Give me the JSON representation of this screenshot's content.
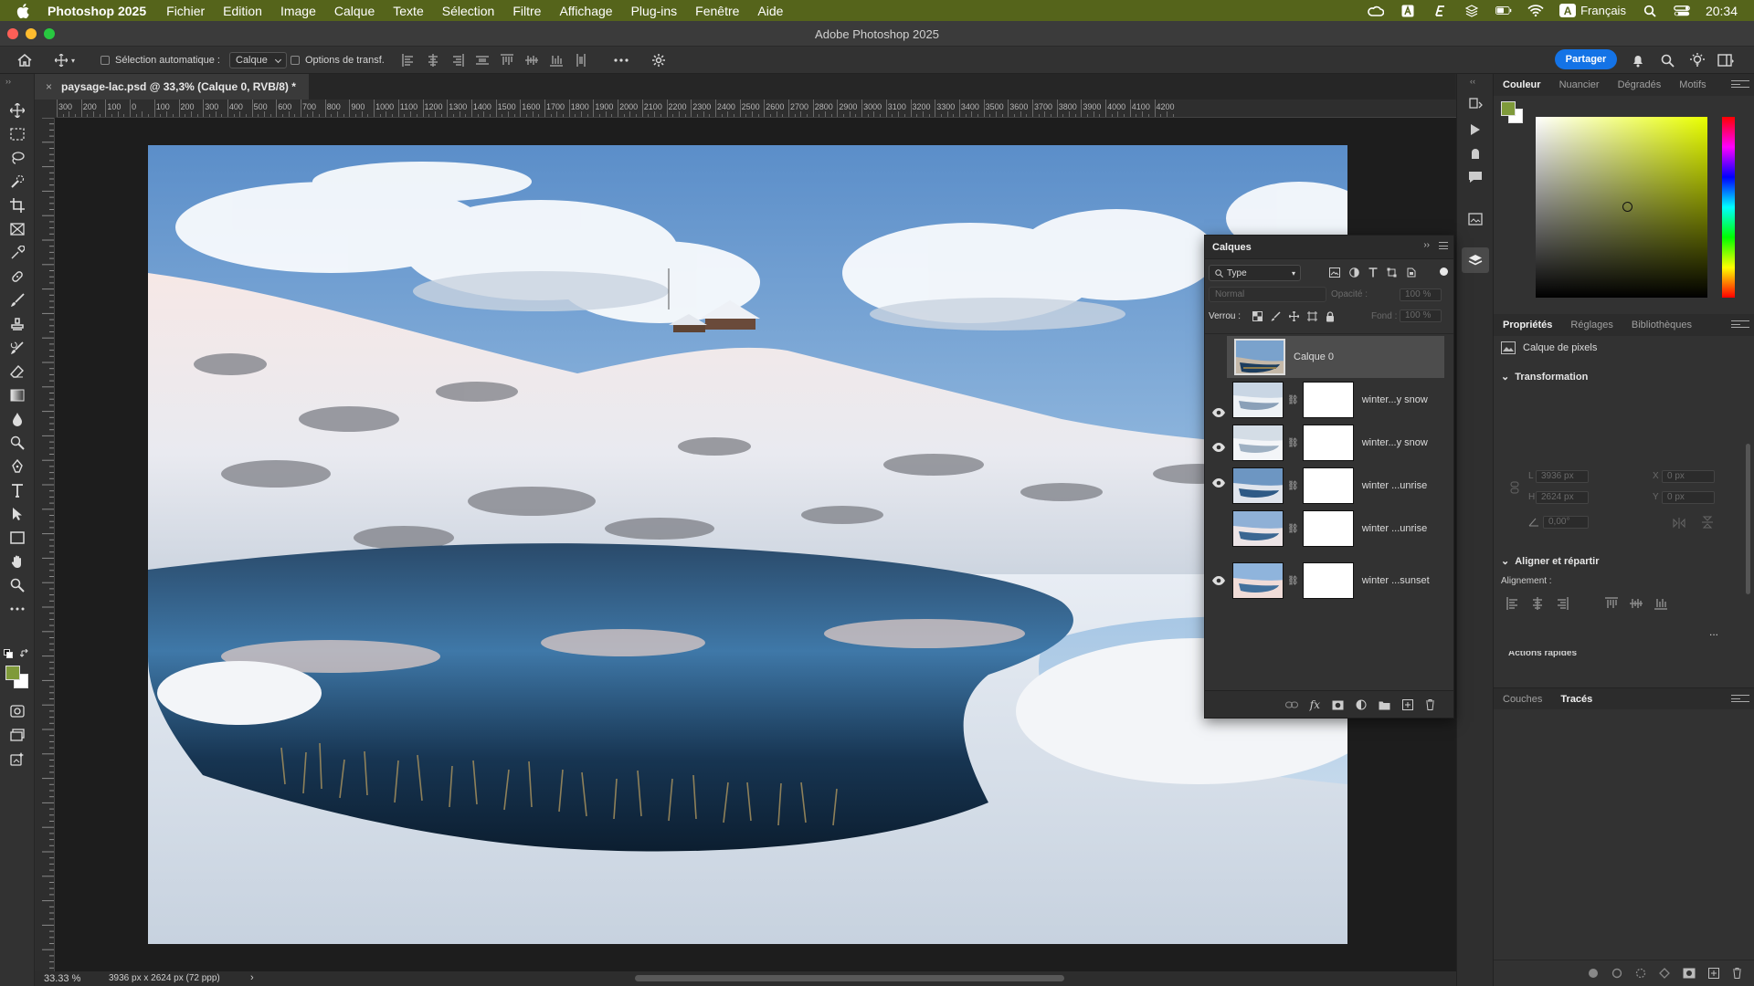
{
  "system": {
    "app_name": "Photoshop 2025",
    "menus": [
      "Fichier",
      "Edition",
      "Image",
      "Calque",
      "Texte",
      "Sélection",
      "Filtre",
      "Affichage",
      "Plug-ins",
      "Fenêtre",
      "Aide"
    ],
    "input_source": "Français",
    "input_badge": "A",
    "clock": "20:34"
  },
  "window": {
    "title": "Adobe Photoshop 2025"
  },
  "options_bar": {
    "auto_select_label": "Sélection automatique :",
    "auto_select_value": "Calque",
    "transform_label": "Options de transf.",
    "share_label": "Partager"
  },
  "document": {
    "tab_title": "paysage-lac.psd @ 33,3% (Calque 0, RVB/8) *",
    "ruler_ticks": [
      "300",
      "200",
      "100",
      "0",
      "100",
      "200",
      "300",
      "400",
      "500",
      "600",
      "700",
      "800",
      "900",
      "1000",
      "1100",
      "1200",
      "1300",
      "1400",
      "1500",
      "1600",
      "1700",
      "1800",
      "1900",
      "2000",
      "2100",
      "2200",
      "2300",
      "2400",
      "2500",
      "2600",
      "2700",
      "2800",
      "2900",
      "3000",
      "3100",
      "3200",
      "3300",
      "3400",
      "3500",
      "3600",
      "3700",
      "3800",
      "3900",
      "4000",
      "4100",
      "4200"
    ]
  },
  "status": {
    "zoom": "33.33 %",
    "info": "3936 px x 2624 px (72 ppp)",
    "arrow": "›"
  },
  "color_panel": {
    "tabs": [
      "Couleur",
      "Nuancier",
      "Dégradés",
      "Motifs"
    ],
    "foreground": "#7f9a3a",
    "background": "#ffffff"
  },
  "properties_panel": {
    "tabs": [
      "Propriétés",
      "Réglages",
      "Bibliothèques"
    ],
    "layer_kind": "Calque de pixels",
    "transformation_title": "Transformation",
    "w_label": "L",
    "w_value": "3936 px",
    "h_label": "H",
    "h_value": "2624 px",
    "x_label": "X",
    "x_value": "0 px",
    "y_label": "Y",
    "y_value": "0 px",
    "angle_value": "0,00°",
    "align_title": "Aligner et répartir",
    "align_label": "Alignement :",
    "quick_actions": "Actions rapides",
    "more": "..."
  },
  "paths_panel": {
    "tabs": [
      "Couches",
      "Tracés"
    ]
  },
  "layers_panel": {
    "title": "Calques",
    "filter_kind": "Type",
    "blend_mode": "Normal",
    "opacity_label": "Opacité :",
    "opacity_value": "100 %",
    "lock_label": "Verrou :",
    "fill_label": "Fond :",
    "fill_value": "100 %",
    "layers": [
      {
        "name": "Calque 0",
        "visible": false,
        "selected": true,
        "mask": false
      },
      {
        "name": "winter...y snow",
        "visible": false,
        "selected": false,
        "mask": true
      },
      {
        "name": "winter...y snow",
        "visible": false,
        "selected": false,
        "mask": true
      },
      {
        "name": "winter ...unrise",
        "visible": true,
        "selected": false,
        "mask": true
      },
      {
        "name": "winter ...unrise",
        "visible": true,
        "selected": false,
        "mask": true
      },
      {
        "name": "winter ...sunset",
        "visible": true,
        "selected": false,
        "mask": true
      }
    ]
  }
}
